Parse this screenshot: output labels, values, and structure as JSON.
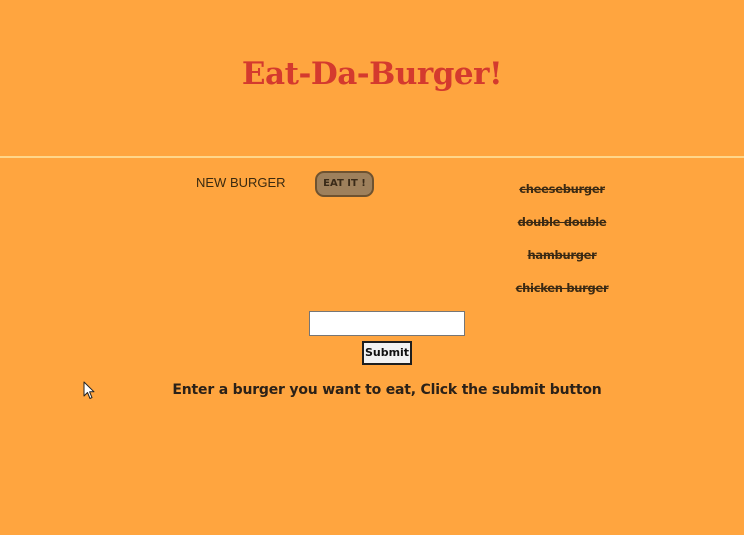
{
  "header": {
    "title": "Eat-Da-Burger!"
  },
  "new_burgers": [
    {
      "name": "NEW BURGER",
      "button_label": "EAT IT !"
    }
  ],
  "eaten_burgers": [
    "cheeseburger",
    "double double",
    "hamburger",
    "chicken burger"
  ],
  "form": {
    "input_value": "",
    "submit_label": "Submit",
    "instructions": "Enter a burger you want to eat, Click the submit button"
  },
  "colors": {
    "background": "#FFA53F",
    "title": "#D43A2E",
    "divider": "#FFD68A",
    "eat_button": "#9E805C"
  },
  "icons": {
    "cursor": "mouse-pointer-icon"
  }
}
